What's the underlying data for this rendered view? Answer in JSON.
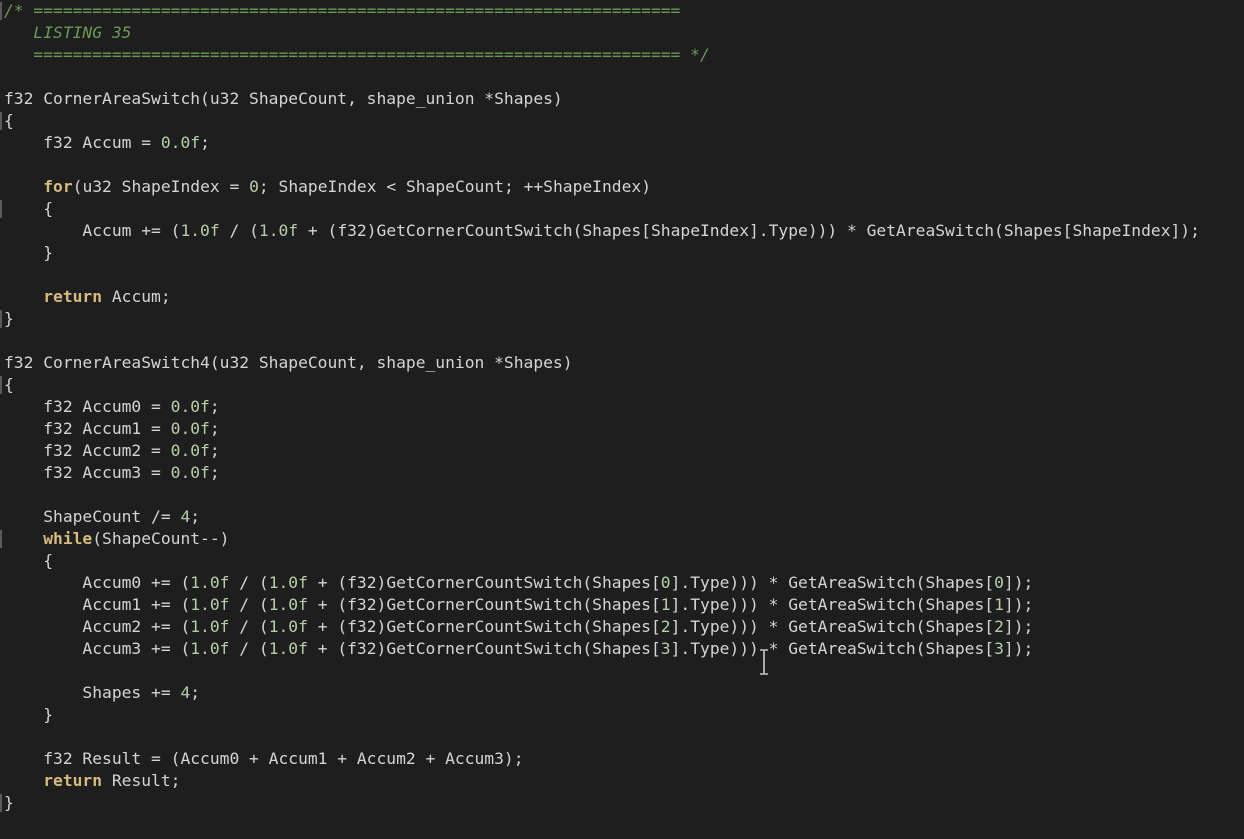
{
  "lines": [
    [
      {
        "t": "/* ==================================================================",
        "c": "cm"
      }
    ],
    [
      {
        "t": "   LISTING 35",
        "c": "cm"
      }
    ],
    [
      {
        "t": "   ================================================================== */",
        "c": "cm"
      }
    ],
    [],
    [
      {
        "t": "f32 CornerAreaSwitch(u32 ShapeCount, shape_union *Shapes)",
        "c": "tx"
      }
    ],
    [
      {
        "t": "{",
        "c": "tx"
      }
    ],
    [
      {
        "t": "    f32 Accum = ",
        "c": "tx"
      },
      {
        "t": "0.0f",
        "c": "num"
      },
      {
        "t": ";",
        "c": "tx"
      }
    ],
    [],
    [
      {
        "t": "    ",
        "c": "tx"
      },
      {
        "t": "for",
        "c": "kw"
      },
      {
        "t": "(u32 ShapeIndex = ",
        "c": "tx"
      },
      {
        "t": "0",
        "c": "num"
      },
      {
        "t": "; ShapeIndex < ShapeCount; ++ShapeIndex)",
        "c": "tx"
      }
    ],
    [
      {
        "t": "    {",
        "c": "tx"
      }
    ],
    [
      {
        "t": "        Accum += (",
        "c": "tx"
      },
      {
        "t": "1.0f",
        "c": "num"
      },
      {
        "t": " / (",
        "c": "tx"
      },
      {
        "t": "1.0f",
        "c": "num"
      },
      {
        "t": " + (f32)GetCornerCountSwitch(Shapes[ShapeIndex].Type))) * GetAreaSwitch(Shapes[ShapeIndex]);",
        "c": "tx"
      }
    ],
    [
      {
        "t": "    }",
        "c": "tx"
      }
    ],
    [],
    [
      {
        "t": "    ",
        "c": "tx"
      },
      {
        "t": "return",
        "c": "kw"
      },
      {
        "t": " Accum;",
        "c": "tx"
      }
    ],
    [
      {
        "t": "}",
        "c": "tx"
      }
    ],
    [],
    [
      {
        "t": "f32 CornerAreaSwitch4(u32 ShapeCount, shape_union *Shapes)",
        "c": "tx"
      }
    ],
    [
      {
        "t": "{",
        "c": "tx"
      }
    ],
    [
      {
        "t": "    f32 Accum0 = ",
        "c": "tx"
      },
      {
        "t": "0.0f",
        "c": "num"
      },
      {
        "t": ";",
        "c": "tx"
      }
    ],
    [
      {
        "t": "    f32 Accum1 = ",
        "c": "tx"
      },
      {
        "t": "0.0f",
        "c": "num"
      },
      {
        "t": ";",
        "c": "tx"
      }
    ],
    [
      {
        "t": "    f32 Accum2 = ",
        "c": "tx"
      },
      {
        "t": "0.0f",
        "c": "num"
      },
      {
        "t": ";",
        "c": "tx"
      }
    ],
    [
      {
        "t": "    f32 Accum3 = ",
        "c": "tx"
      },
      {
        "t": "0.0f",
        "c": "num"
      },
      {
        "t": ";",
        "c": "tx"
      }
    ],
    [],
    [
      {
        "t": "    ShapeCount /= ",
        "c": "tx"
      },
      {
        "t": "4",
        "c": "num"
      },
      {
        "t": ";",
        "c": "tx"
      }
    ],
    [
      {
        "t": "    ",
        "c": "tx"
      },
      {
        "t": "while",
        "c": "kw"
      },
      {
        "t": "(ShapeCount--)",
        "c": "tx"
      }
    ],
    [
      {
        "t": "    {",
        "c": "tx"
      }
    ],
    [
      {
        "t": "        Accum0 += (",
        "c": "tx"
      },
      {
        "t": "1.0f",
        "c": "num"
      },
      {
        "t": " / (",
        "c": "tx"
      },
      {
        "t": "1.0f",
        "c": "num"
      },
      {
        "t": " + (f32)GetCornerCountSwitch(Shapes[",
        "c": "tx"
      },
      {
        "t": "0",
        "c": "num"
      },
      {
        "t": "].Type))) * GetAreaSwitch(Shapes[",
        "c": "tx"
      },
      {
        "t": "0",
        "c": "num"
      },
      {
        "t": "]);",
        "c": "tx"
      }
    ],
    [
      {
        "t": "        Accum1 += (",
        "c": "tx"
      },
      {
        "t": "1.0f",
        "c": "num"
      },
      {
        "t": " / (",
        "c": "tx"
      },
      {
        "t": "1.0f",
        "c": "num"
      },
      {
        "t": " + (f32)GetCornerCountSwitch(Shapes[",
        "c": "tx"
      },
      {
        "t": "1",
        "c": "num"
      },
      {
        "t": "].Type))) * GetAreaSwitch(Shapes[",
        "c": "tx"
      },
      {
        "t": "1",
        "c": "num"
      },
      {
        "t": "]);",
        "c": "tx"
      }
    ],
    [
      {
        "t": "        Accum2 += (",
        "c": "tx"
      },
      {
        "t": "1.0f",
        "c": "num"
      },
      {
        "t": " / (",
        "c": "tx"
      },
      {
        "t": "1.0f",
        "c": "num"
      },
      {
        "t": " + (f32)GetCornerCountSwitch(Shapes[",
        "c": "tx"
      },
      {
        "t": "2",
        "c": "num"
      },
      {
        "t": "].Type))) * GetAreaSwitch(Shapes[",
        "c": "tx"
      },
      {
        "t": "2",
        "c": "num"
      },
      {
        "t": "]);",
        "c": "tx"
      }
    ],
    [
      {
        "t": "        Accum3 += (",
        "c": "tx"
      },
      {
        "t": "1.0f",
        "c": "num"
      },
      {
        "t": " / (",
        "c": "tx"
      },
      {
        "t": "1.0f",
        "c": "num"
      },
      {
        "t": " + (f32)GetCornerCountSwitch(Shapes[",
        "c": "tx"
      },
      {
        "t": "3",
        "c": "num"
      },
      {
        "t": "].Type))) * GetAreaSwitch(Shapes[",
        "c": "tx"
      },
      {
        "t": "3",
        "c": "num"
      },
      {
        "t": "]);",
        "c": "tx"
      }
    ],
    [],
    [
      {
        "t": "        Shapes += ",
        "c": "tx"
      },
      {
        "t": "4",
        "c": "num"
      },
      {
        "t": ";",
        "c": "tx"
      }
    ],
    [
      {
        "t": "    }",
        "c": "tx"
      }
    ],
    [],
    [
      {
        "t": "    f32 Result = (Accum0 + Accum1 + Accum2 + Accum3);",
        "c": "tx"
      }
    ],
    [
      {
        "t": "    ",
        "c": "tx"
      },
      {
        "t": "return",
        "c": "kw"
      },
      {
        "t": " Result;",
        "c": "tx"
      }
    ],
    [
      {
        "t": "}",
        "c": "tx"
      }
    ]
  ],
  "colors": {
    "background": "#1e1e1e",
    "text": "#d4d4d4",
    "comment": "#6a9955",
    "keyword": "#d7ba7d",
    "number": "#b5cea8"
  },
  "icons": {
    "cursor": "text-ibeam-cursor-icon"
  }
}
